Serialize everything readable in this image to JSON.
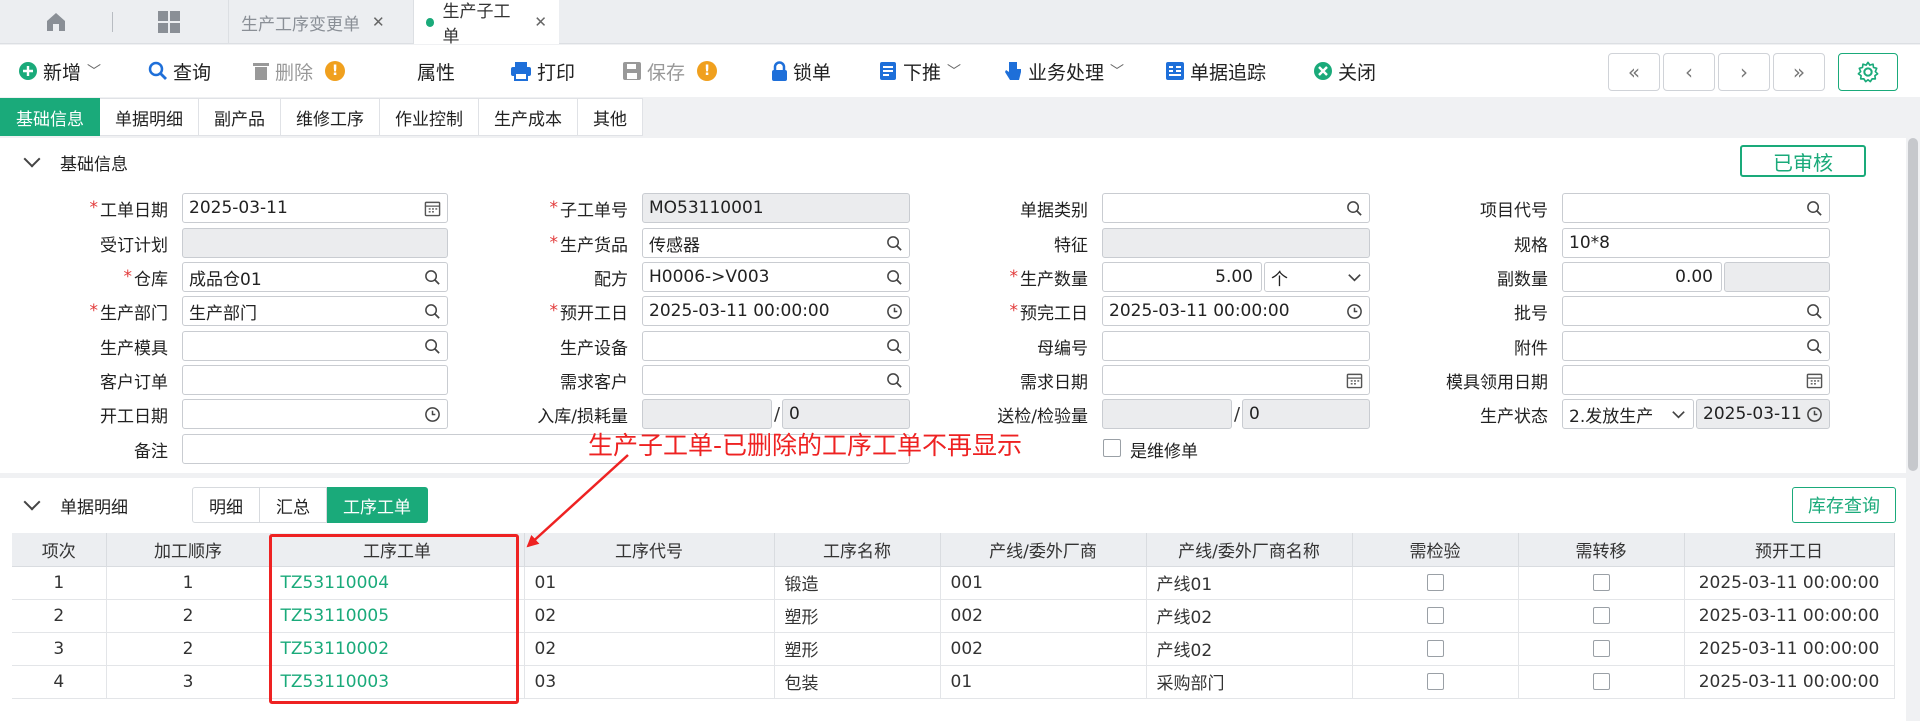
{
  "tabs": [
    {
      "label": "生产工序变更单",
      "active": false
    },
    {
      "label": "生产子工单",
      "active": true
    }
  ],
  "toolbar": {
    "new": "新增",
    "query": "查询",
    "delete": "删除",
    "attributes": "属性",
    "print": "打印",
    "save": "保存",
    "lock": "锁单",
    "push_down": "下推",
    "business": "业务处理",
    "trace": "单据追踪",
    "close": "关闭",
    "warn_mark": "!"
  },
  "section_tabs": [
    "基础信息",
    "单据明细",
    "副产品",
    "维修工序",
    "作业控制",
    "生产成本",
    "其他"
  ],
  "basic": {
    "title": "基础信息",
    "status_badge": "已审核",
    "fields": {
      "work_date": {
        "label": "工单日期",
        "value": "2025-03-11"
      },
      "order_plan": {
        "label": "受订计划",
        "value": ""
      },
      "warehouse": {
        "label": "仓库",
        "value": "成品仓01"
      },
      "dept": {
        "label": "生产部门",
        "value": "生产部门"
      },
      "mold": {
        "label": "生产模具",
        "value": ""
      },
      "customer_order": {
        "label": "客户订单",
        "value": ""
      },
      "start_date": {
        "label": "开工日期",
        "value": ""
      },
      "remark": {
        "label": "备注",
        "value": ""
      },
      "sub_no": {
        "label": "子工单号",
        "value": "MO53110001"
      },
      "product": {
        "label": "生产货品",
        "value": "传感器"
      },
      "formula": {
        "label": "配方",
        "value": "H0006->V003"
      },
      "plan_start": {
        "label": "预开工日",
        "value": "2025-03-11 00:00:00"
      },
      "equipment": {
        "label": "生产设备",
        "value": ""
      },
      "demand_customer": {
        "label": "需求客户",
        "value": ""
      },
      "in_loss": {
        "label": "入库/损耗量",
        "value1": "",
        "value2": "0"
      },
      "doc_type": {
        "label": "单据类别",
        "value": ""
      },
      "feature": {
        "label": "特征",
        "value": ""
      },
      "qty": {
        "label": "生产数量",
        "value": "5.00",
        "unit": "个"
      },
      "plan_end": {
        "label": "预完工日",
        "value": "2025-03-11 00:00:00"
      },
      "parent_no": {
        "label": "母编号",
        "value": ""
      },
      "demand_date": {
        "label": "需求日期",
        "value": ""
      },
      "inspect": {
        "label": "送检/检验量",
        "value1": "",
        "value2": "0"
      },
      "is_repair": {
        "label": "是维修单"
      },
      "project": {
        "label": "项目代号",
        "value": ""
      },
      "spec": {
        "label": "规格",
        "value": "10*8"
      },
      "sub_qty": {
        "label": "副数量",
        "value": "0.00",
        "value2": ""
      },
      "batch": {
        "label": "批号",
        "value": ""
      },
      "attachment": {
        "label": "附件",
        "value": ""
      },
      "mold_date": {
        "label": "模具领用日期",
        "value": ""
      },
      "status": {
        "label": "生产状态",
        "value": "2.发放生产",
        "date": "2025-03-11"
      }
    }
  },
  "detail": {
    "title": "单据明细",
    "tabs": [
      "明细",
      "汇总",
      "工序工单"
    ],
    "stock_query": "库存查询",
    "columns": [
      "项次",
      "加工顺序",
      "工序工单",
      "工序代号",
      "工序名称",
      "产线/委外厂商",
      "产线/委外厂商名称",
      "需检验",
      "需转移",
      "预开工日"
    ],
    "rows": [
      {
        "item": "1",
        "seq": "1",
        "order": "TZ53110004",
        "code": "01",
        "name": "锻造",
        "line": "001",
        "line_name": "产线01",
        "start": "2025-03-11 00:00:00"
      },
      {
        "item": "2",
        "seq": "2",
        "order": "TZ53110005",
        "code": "02",
        "name": "塑形",
        "line": "002",
        "line_name": "产线02",
        "start": "2025-03-11 00:00:00"
      },
      {
        "item": "3",
        "seq": "2",
        "order": "TZ53110002",
        "code": "02",
        "name": "塑形",
        "line": "002",
        "line_name": "产线02",
        "start": "2025-03-11 00:00:00"
      },
      {
        "item": "4",
        "seq": "3",
        "order": "TZ53110003",
        "code": "03",
        "name": "包装",
        "line": "01",
        "line_name": "采购部门",
        "start": "2025-03-11 00:00:00"
      }
    ]
  },
  "annotation": "生产子工单-已删除的工序工单不再显示",
  "colors": {
    "accent": "#1aaa7a",
    "annotation": "#ee2222",
    "warning": "#f0a01e",
    "required": "#e23a3a"
  }
}
